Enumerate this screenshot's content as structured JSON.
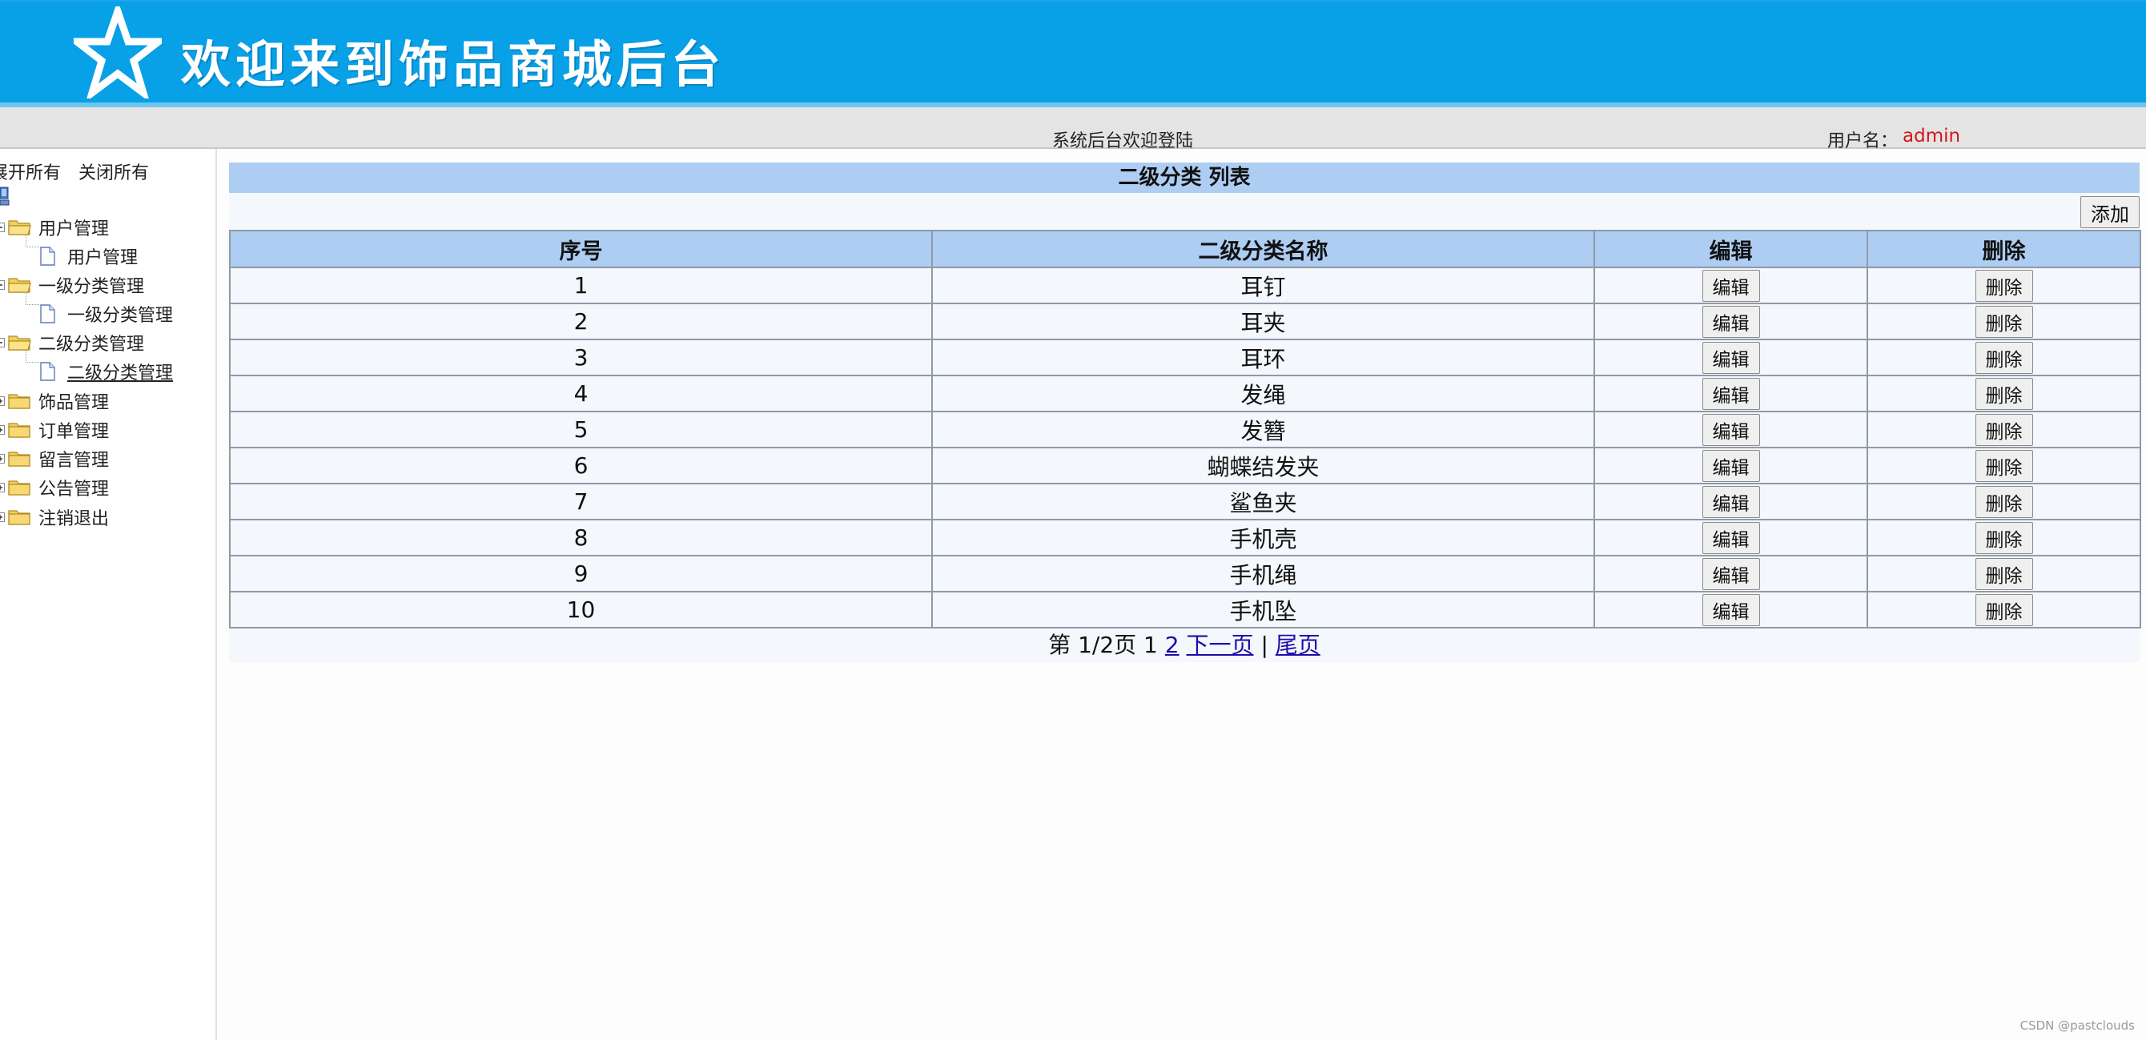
{
  "header": {
    "title": "欢迎来到饰品商城后台",
    "welcome": "系统后台欢迎登陆",
    "user_label": "用户名：",
    "username": "admin"
  },
  "sidebar": {
    "expand_all": "展开所有",
    "collapse_all": "关闭所有",
    "nodes": [
      {
        "label": "用户管理",
        "children": [
          "用户管理"
        ]
      },
      {
        "label": "一级分类管理",
        "children": [
          "一级分类管理"
        ]
      },
      {
        "label": "二级分类管理",
        "children": [
          "二级分类管理"
        ]
      },
      {
        "label": "饰品管理"
      },
      {
        "label": "订单管理"
      },
      {
        "label": "留言管理"
      },
      {
        "label": "公告管理"
      },
      {
        "label": "注销退出"
      }
    ]
  },
  "main": {
    "title": "二级分类 列表",
    "add_label": "添加",
    "columns": [
      "序号",
      "二级分类名称",
      "编辑",
      "删除"
    ],
    "edit_label": "编辑",
    "delete_label": "删除",
    "rows": [
      {
        "id": "1",
        "name": "耳钉"
      },
      {
        "id": "2",
        "name": "耳夹"
      },
      {
        "id": "3",
        "name": "耳环"
      },
      {
        "id": "4",
        "name": "发绳"
      },
      {
        "id": "5",
        "name": "发簪"
      },
      {
        "id": "6",
        "name": "蝴蝶结发夹"
      },
      {
        "id": "7",
        "name": "鲨鱼夹"
      },
      {
        "id": "8",
        "name": "手机壳"
      },
      {
        "id": "9",
        "name": "手机绳"
      },
      {
        "id": "10",
        "name": "手机坠"
      }
    ],
    "pager": {
      "page_info": "第 1/2页 1",
      "page_2": "2",
      "next": "下一页",
      "separator": "|",
      "last": "尾页"
    }
  },
  "watermark": "CSDN @pastclouds",
  "colors": {
    "banner": "#08a0e6",
    "table_header": "#aecdf3",
    "username": "#d4161c"
  }
}
